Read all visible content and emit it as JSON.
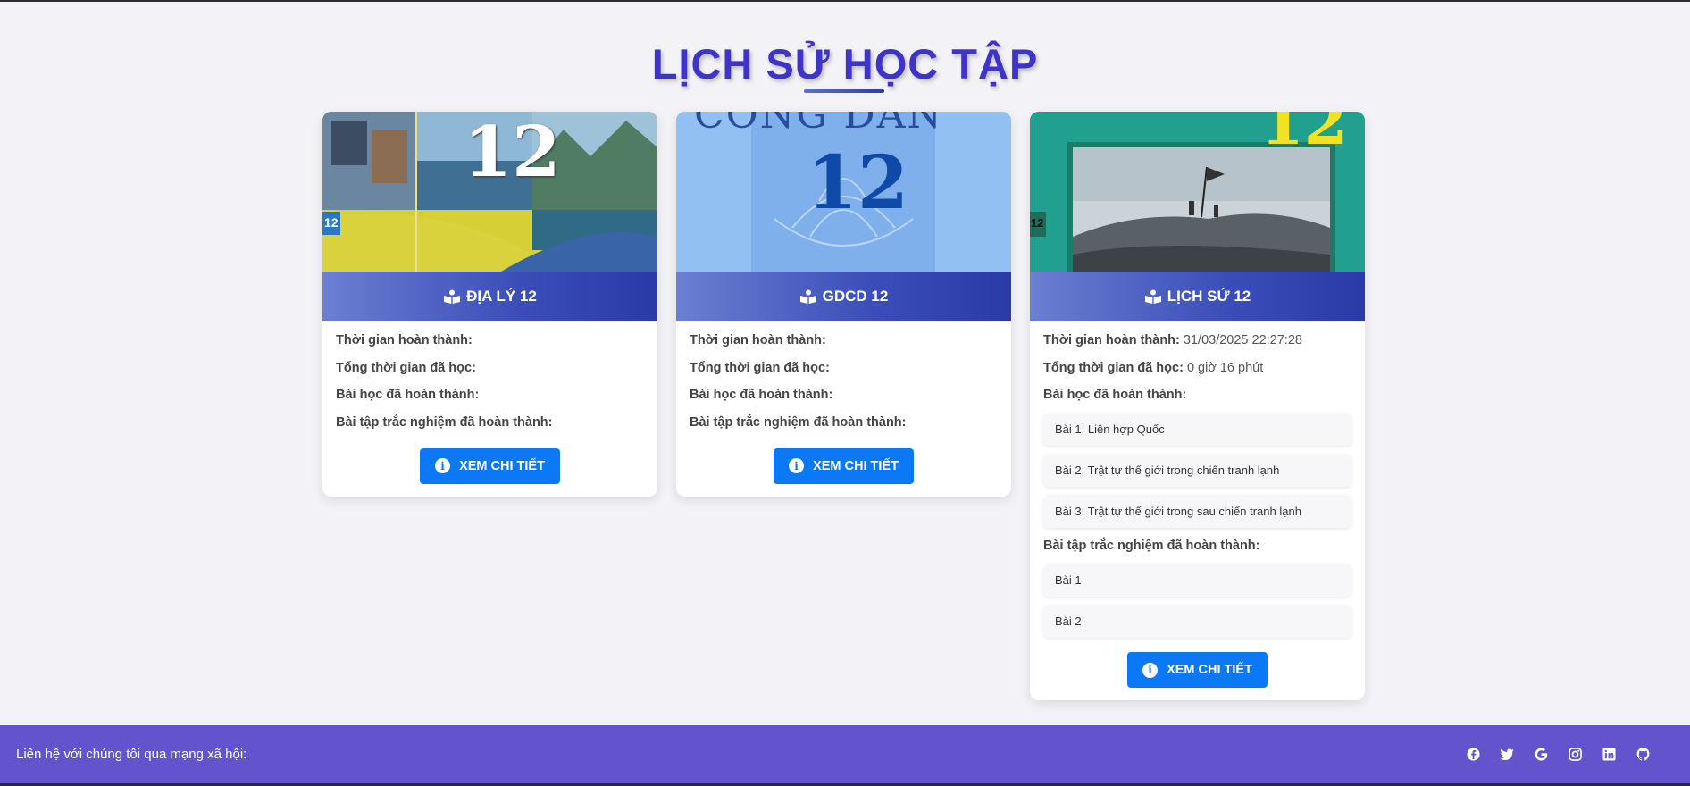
{
  "page_title": "LỊCH SỬ HỌC TẬP",
  "cards": [
    {
      "subject": "ĐỊA LÝ 12",
      "labels": {
        "completion_time": "Thời gian hoàn thành:",
        "total_time": "Tổng thời gian đã học:",
        "lessons_done": "Bài học đã hoàn thành:",
        "quizzes_done": "Bài tập trắc nghiệm đã hoàn thành:"
      },
      "completion_time": "",
      "total_time": "",
      "lessons": [],
      "quizzes": [],
      "button_label": "XEM CHI TIẾT"
    },
    {
      "subject": "GDCD 12",
      "labels": {
        "completion_time": "Thời gian hoàn thành:",
        "total_time": "Tổng thời gian đã học:",
        "lessons_done": "Bài học đã hoàn thành:",
        "quizzes_done": "Bài tập trắc nghiệm đã hoàn thành:"
      },
      "completion_time": "",
      "total_time": "",
      "lessons": [],
      "quizzes": [],
      "button_label": "XEM CHI TIẾT"
    },
    {
      "subject": "LỊCH SỬ 12",
      "labels": {
        "completion_time": "Thời gian hoàn thành:",
        "total_time": "Tổng thời gian đã học:",
        "lessons_done": "Bài học đã hoàn thành:",
        "quizzes_done": "Bài tập trắc nghiệm đã hoàn thành:"
      },
      "completion_time": "31/03/2025 22:27:28",
      "total_time": "0 giờ 16 phút",
      "lessons": [
        "Bài 1: Liên hợp Quốc",
        "Bài 2: Trật tự thế giới trong chiến tranh lạnh",
        "Bài 3: Trật tự thế giới trong sau chiến tranh lạnh"
      ],
      "quizzes": [
        "Bài 1",
        "Bài 2"
      ],
      "button_label": "XEM CHI TIẾT"
    }
  ],
  "covers": {
    "dialy_number": "12",
    "dialy_badge": "12",
    "gdcd_number": "12",
    "gdcd_heading": "CÔNG DÂN",
    "lichsu_number": "12",
    "lichsu_badge": "12"
  },
  "colors": {
    "title": "#3f33c8",
    "card_header_start": "#6b7fd2",
    "card_header_end": "#2a3aa6",
    "button": "#0b79f5",
    "footer": "#6353cc"
  },
  "footer": {
    "contact_text": "Liên hệ với chúng tôi qua mạng xã hội:",
    "socials": [
      "facebook-icon",
      "twitter-icon",
      "google-icon",
      "instagram-icon",
      "linkedin-icon",
      "github-icon"
    ]
  }
}
